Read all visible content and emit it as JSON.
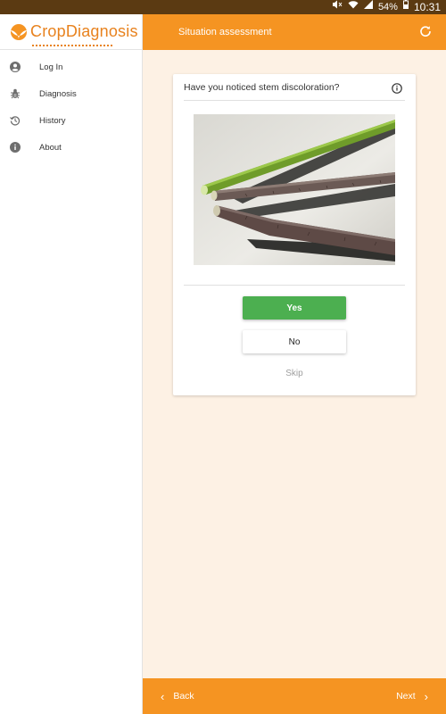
{
  "status_bar": {
    "icons": [
      "mute-icon",
      "wifi-icon",
      "signal-icon",
      "battery-icon"
    ],
    "battery": "54%",
    "time": "10:31"
  },
  "sidebar": {
    "logo_text": "CropDiagnosis",
    "items": [
      {
        "label": "Log In",
        "icon": "account-icon"
      },
      {
        "label": "Diagnosis",
        "icon": "bug-icon"
      },
      {
        "label": "History",
        "icon": "history-icon"
      },
      {
        "label": "About",
        "icon": "info-icon"
      }
    ]
  },
  "appbar": {
    "title": "Situation assessment",
    "action_icon": "refresh-icon"
  },
  "question_card": {
    "question": "Have you noticed stem discoloration?",
    "info_icon": "info-icon",
    "yes_label": "Yes",
    "no_label": "No",
    "skip_label": "Skip"
  },
  "bottom_bar": {
    "back_label": "Back",
    "next_label": "Next"
  },
  "colors": {
    "accent": "#f59422",
    "brand_text": "#e8821e",
    "yes_green": "#4caf50",
    "background": "#fdf1e4",
    "status_bar": "#5b3a12"
  }
}
